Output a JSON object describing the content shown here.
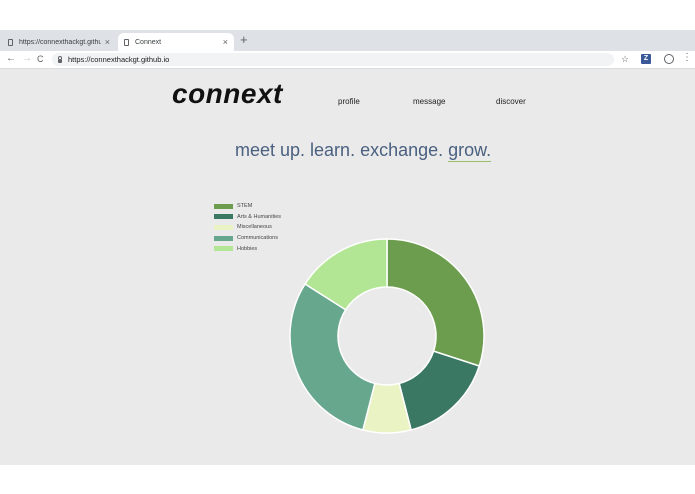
{
  "browser": {
    "tabs": [
      {
        "title": "https://connexthackgt.github.i",
        "close": "×"
      },
      {
        "title": "Connext",
        "close": "×"
      }
    ],
    "new_tab": "+",
    "url": "https://connexthackgt.github.io",
    "back": "←",
    "forward": "→",
    "reload": "C",
    "star": "☆",
    "extension_label": "Z",
    "menu": "⋮"
  },
  "site": {
    "logo": "connext",
    "nav": {
      "profile": "profile",
      "message": "message",
      "discover": "discover"
    },
    "tagline": {
      "main": "meet up. learn. exchange. ",
      "accent": "grow."
    }
  },
  "chart_data": {
    "type": "pie",
    "donut": true,
    "categories": [
      "STEM",
      "Arts & Humanities",
      "Miscellaneous",
      "Communications",
      "Hobbies"
    ],
    "values": [
      30,
      16,
      8,
      30,
      16
    ],
    "colors": [
      "#6c9d4e",
      "#3a7863",
      "#e9f3c4",
      "#67a78e",
      "#b2e694"
    ],
    "legend": "top-left"
  }
}
